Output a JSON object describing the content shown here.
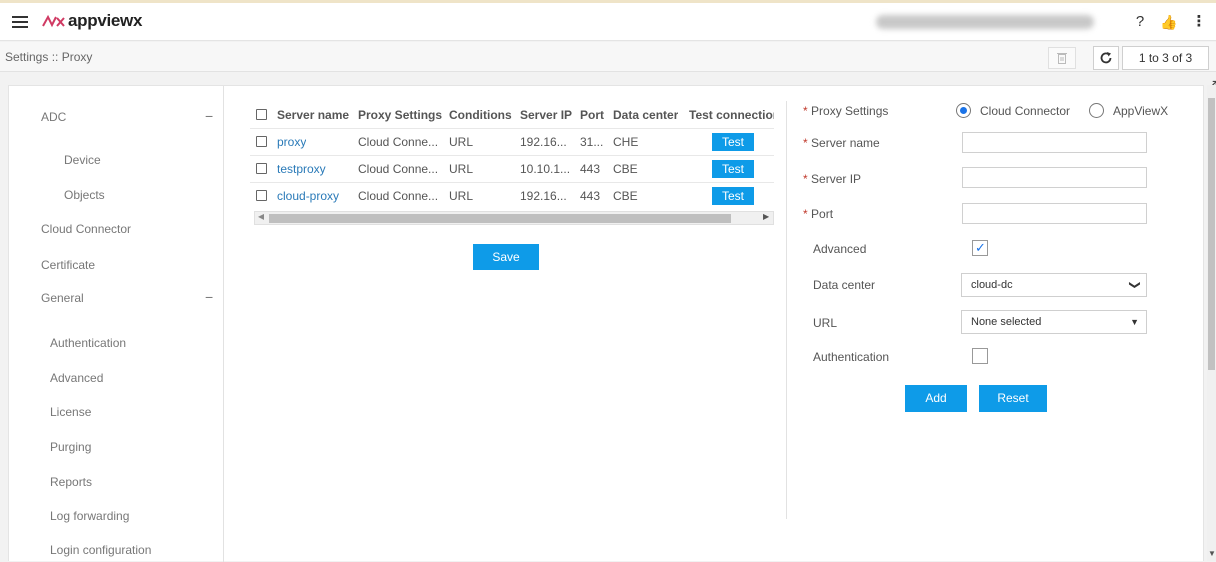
{
  "header": {
    "logo_text": "appviewx",
    "help_glyph": "?",
    "like_glyph": "👍",
    "more_glyph": "⋮"
  },
  "subbar": {
    "breadcrumb": "Settings :: Proxy",
    "pager": "1 to 3 of 3"
  },
  "sidebar": {
    "items": [
      {
        "label": "ADC",
        "collapse": "−"
      },
      {
        "label": "Device"
      },
      {
        "label": "Objects"
      },
      {
        "label": "Cloud Connector"
      },
      {
        "label": "Certificate"
      },
      {
        "label": "General",
        "collapse": "−"
      },
      {
        "label": "Authentication"
      },
      {
        "label": "Advanced"
      },
      {
        "label": "License"
      },
      {
        "label": "Purging"
      },
      {
        "label": "Reports"
      },
      {
        "label": "Log forwarding"
      },
      {
        "label": "Login configuration"
      }
    ]
  },
  "table": {
    "columns": [
      "Server name",
      "Proxy Settings",
      "Conditions",
      "Server IP",
      "Port",
      "Data center",
      "Test connection"
    ],
    "rows": [
      {
        "name": "proxy",
        "proxy_settings": "Cloud Conne...",
        "conditions": "URL",
        "server_ip": "192.16...",
        "port": "31...",
        "data_center": "CHE",
        "test_label": "Test"
      },
      {
        "name": "testproxy",
        "proxy_settings": "Cloud Conne...",
        "conditions": "URL",
        "server_ip": "10.10.1...",
        "port": "443",
        "data_center": "CBE",
        "test_label": "Test"
      },
      {
        "name": "cloud-proxy",
        "proxy_settings": "Cloud Conne...",
        "conditions": "URL",
        "server_ip": "192.16...",
        "port": "443",
        "data_center": "CBE",
        "test_label": "Test"
      }
    ]
  },
  "save_label": "Save",
  "form": {
    "required_mark": "*",
    "proxy_settings_label": "Proxy Settings",
    "option_cloud_connector": "Cloud Connector",
    "option_appviewx": "AppViewX",
    "selected_option": "Cloud Connector",
    "server_name_label": "Server name",
    "server_name_value": "",
    "server_ip_label": "Server IP",
    "server_ip_value": "",
    "port_label": "Port",
    "port_value": "",
    "advanced_label": "Advanced",
    "advanced_checked": true,
    "check_glyph": "✓",
    "data_center_label": "Data center",
    "data_center_value": "cloud-dc",
    "url_label": "URL",
    "url_value": "None selected",
    "authentication_label": "Authentication",
    "authentication_checked": false,
    "add_label": "Add",
    "reset_label": "Reset"
  },
  "colors": {
    "accent": "#0e9be8",
    "link": "#2a7ab8",
    "required": "#c0392b",
    "logo_mark": "#d03a63"
  },
  "icons": [
    "hamburger-icon",
    "help-icon",
    "thumbs-up-icon",
    "more-vertical-icon",
    "trash-icon",
    "refresh-icon",
    "chevron-down-icon",
    "caret-down-icon"
  ]
}
